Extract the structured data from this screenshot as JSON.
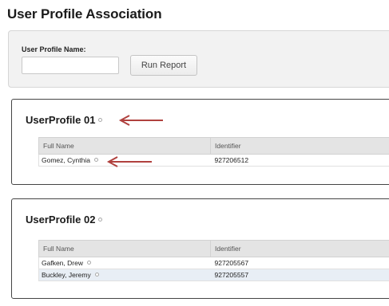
{
  "page": {
    "title": "User Profile Association"
  },
  "filter": {
    "label": "User Profile Name:",
    "input_value": "",
    "input_placeholder": "",
    "run_button_label": "Run Report"
  },
  "profiles": [
    {
      "name": "UserProfile 01",
      "columns": [
        "Full Name",
        "Identifier"
      ],
      "rows": [
        {
          "full_name": "Gomez, Cynthia",
          "identifier": "927206512"
        }
      ]
    },
    {
      "name": "UserProfile 02",
      "columns": [
        "Full Name",
        "Identifier"
      ],
      "rows": [
        {
          "full_name": "Gafken, Drew",
          "identifier": "927205567"
        },
        {
          "full_name": "Buckley, Jeremy",
          "identifier": "927205557"
        }
      ]
    }
  ],
  "colors": {
    "annotation_arrow": "#b0413e",
    "header_bg": "#e4e4e4",
    "alt_row_bg": "#e8eef5"
  },
  "icons": {
    "status_dot": "circle-icon",
    "annotation": "arrow-left-icon"
  }
}
